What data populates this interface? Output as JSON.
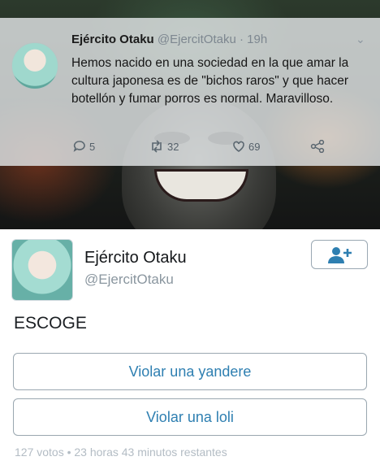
{
  "quoted_tweet": {
    "author_name": "Ejército Otaku",
    "handle": "@EjercitOtaku",
    "separator": "·",
    "time": "19h",
    "text": "Hemos nacido en una sociedad en la que amar la cultura japonesa es de \"bichos raros\" y que hacer botellón y fumar porros es normal. Maravilloso.",
    "replies": "5",
    "retweets": "32",
    "likes": "69",
    "icons": [
      "caret-down-icon",
      "reply-icon",
      "retweet-icon",
      "heart-icon",
      "share-icon"
    ]
  },
  "poll_tweet": {
    "author_name": "Ejército Otaku",
    "handle": "@EjercitOtaku",
    "question": "ESCOGE",
    "options": [
      {
        "label": "Violar una yandere"
      },
      {
        "label": "Violar una loli"
      }
    ],
    "footer": "127 votos • 23 horas 43 minutos restantes",
    "follow_icon": "add-user-icon"
  },
  "colors": {
    "link_blue": "#2e7fb1",
    "muted_gray": "#8a969f",
    "border_gray": "#9aa7b0"
  }
}
